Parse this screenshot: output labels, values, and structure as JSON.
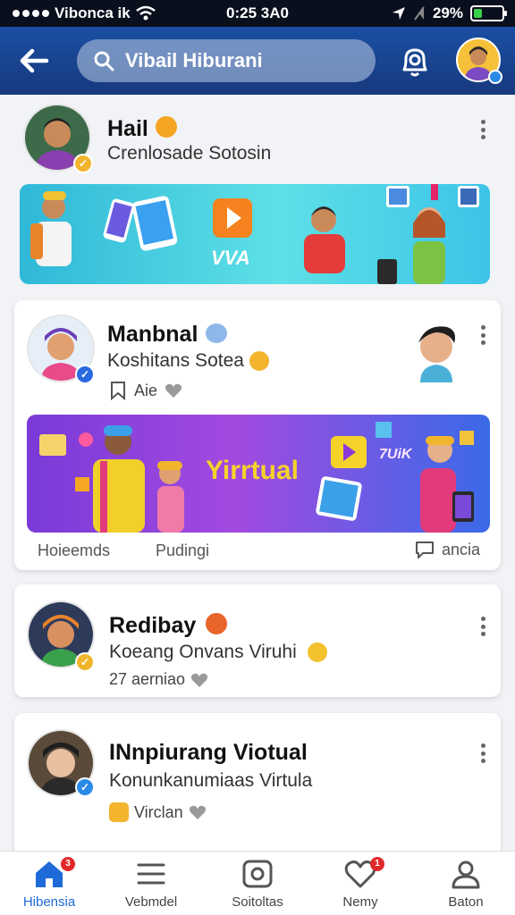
{
  "status_bar": {
    "carrier": "Vibonca ik",
    "time": "0:25 3A0",
    "battery": "29%",
    "battery_level": 0.29,
    "battery_color": "#3ad14a"
  },
  "header": {
    "back_icon": "arrow-left-icon",
    "search_placeholder": "Vibail Hiburani",
    "notification_icon": "notification-bell-icon",
    "accent_color": "#1b4fa3"
  },
  "feed": {
    "posts": [
      {
        "name": "Hail",
        "subtitle": "Crenlosade Sotosin"
      },
      {
        "name": "Manbnal",
        "subtitle": "Koshitans Sotea",
        "meta": "Aie",
        "banner_title": "Yirrtual",
        "banner_tag": "7UiK",
        "action_left": "Hoieemds",
        "action_middle": "Pudingi",
        "action_right": "ancia"
      },
      {
        "name": "Redibay",
        "subtitle": "Koeang Onvans Viruhi",
        "meta": "27 aerniao"
      },
      {
        "name": "INnpiurang Viotual",
        "subtitle": "Konunkanumiaas Virtula",
        "meta": "Virclan"
      }
    ],
    "first_banner_text": "VVA"
  },
  "bottom_nav": {
    "items": [
      {
        "label": "Hibensia",
        "icon": "home-icon",
        "badge": "3"
      },
      {
        "label": "Vebmdel",
        "icon": "menu-icon"
      },
      {
        "label": "Soitoltas",
        "icon": "photo-icon"
      },
      {
        "label": "Nemy",
        "icon": "heart-icon",
        "badge": "1"
      },
      {
        "label": "Baton",
        "icon": "profile-icon"
      }
    ],
    "active_color": "#1e6ad8"
  }
}
